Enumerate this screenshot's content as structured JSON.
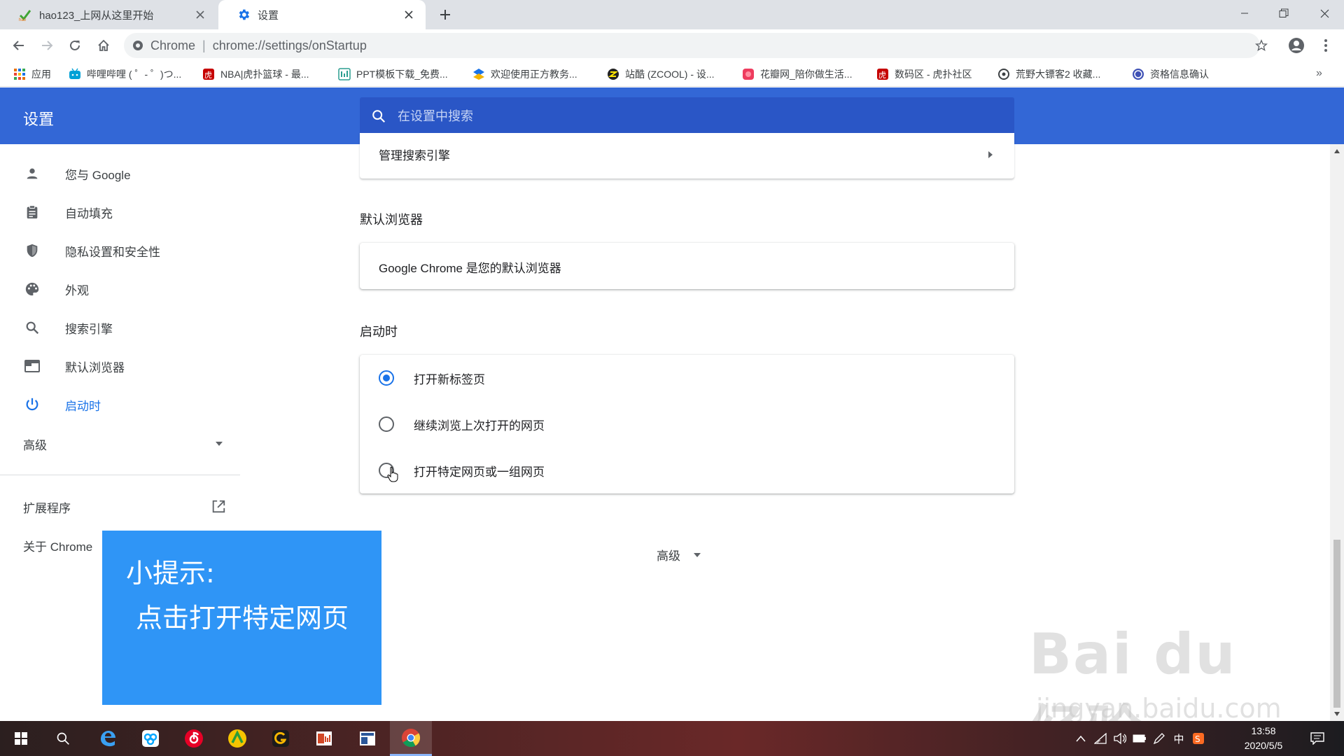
{
  "browser": {
    "tabs": [
      {
        "title": "hao123_上网从这里开始",
        "active": false
      },
      {
        "title": "设置",
        "active": true
      }
    ],
    "omnibox": {
      "scheme_label": "Chrome",
      "url": "chrome://settings/onStartup"
    },
    "bookmarks": [
      {
        "label": "应用",
        "icon": "apps-grid-icon"
      },
      {
        "label": "哔哩哔哩 ( ゜- ゜)つ...",
        "icon": "bilibili-icon"
      },
      {
        "label": "NBA|虎扑篮球 - 最...",
        "icon": "hupu-icon"
      },
      {
        "label": "PPT模板下载_免费...",
        "icon": "ppt-icon"
      },
      {
        "label": "欢迎使用正方教务...",
        "icon": "jiaowu-icon"
      },
      {
        "label": "站酷 (ZCOOL) - 设...",
        "icon": "zcool-icon"
      },
      {
        "label": "花瓣网_陪你做生活...",
        "icon": "huaban-icon"
      },
      {
        "label": "数码区 - 虎扑社区",
        "icon": "hupu-icon"
      },
      {
        "label": "荒野大镖客2 收藏...",
        "icon": "steam-icon"
      },
      {
        "label": "资格信息确认",
        "icon": "seal-icon"
      }
    ],
    "bookmarks_more": "»"
  },
  "settings": {
    "title": "设置",
    "search_placeholder": "在设置中搜索",
    "sidebar": {
      "items": [
        {
          "label": "您与 Google",
          "icon": "person-icon"
        },
        {
          "label": "自动填充",
          "icon": "clipboard-icon"
        },
        {
          "label": "隐私设置和安全性",
          "icon": "shield-icon"
        },
        {
          "label": "外观",
          "icon": "palette-icon"
        },
        {
          "label": "搜索引擎",
          "icon": "search-icon"
        },
        {
          "label": "默认浏览器",
          "icon": "browser-window-icon"
        },
        {
          "label": "启动时",
          "icon": "power-icon",
          "active": true
        }
      ],
      "advanced": "高级",
      "extensions": "扩展程序",
      "about": "关于 Chrome"
    },
    "main": {
      "manage_search_engines": "管理搜索引擎",
      "default_browser_title": "默认浏览器",
      "default_browser_text": "Google Chrome 是您的默认浏览器",
      "startup_title": "启动时",
      "startup_options": [
        {
          "label": "打开新标签页",
          "checked": true
        },
        {
          "label": "继续浏览上次打开的网页",
          "checked": false
        },
        {
          "label": "打开特定网页或一组网页",
          "checked": false
        }
      ],
      "advanced": "高级"
    }
  },
  "tip": {
    "title": "小提示:",
    "body": "点击打开特定网页"
  },
  "watermark": {
    "brand": "Bai du 经验",
    "url": "jingyan.baidu.com"
  },
  "taskbar": {
    "apps": [
      "windows-start-icon",
      "search-icon",
      "edge-icon",
      "baidu-netdisk-icon",
      "netease-music-icon",
      "app-green-icon",
      "app-g-icon",
      "powerpoint-icon",
      "word-icon",
      "chrome-icon"
    ],
    "ime": "中",
    "time": "13:58",
    "date": "2020/5/5"
  },
  "colors": {
    "header_blue": "#3367d6",
    "accent": "#1a73e8",
    "tip_blue": "#2f95f6"
  }
}
